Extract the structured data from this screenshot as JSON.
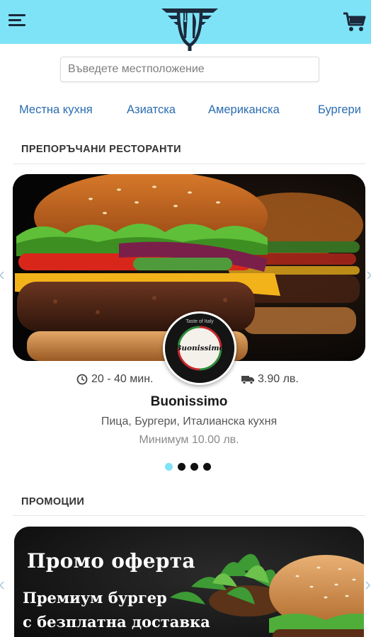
{
  "header": {
    "menu_icon": "hamburger-menu-icon",
    "logo_icon": "fork-knife-logo-icon",
    "cart_icon": "shopping-cart-icon",
    "bar_color": "#7fe3f7"
  },
  "search": {
    "placeholder": "Въведете местположение"
  },
  "categories": [
    "Местна кухня",
    "Азиатска",
    "Американска",
    "Бургери"
  ],
  "recommended": {
    "title": "ПРЕПОРЪЧАНИ РЕСТОРАНТИ",
    "restaurant": {
      "delivery_time": "20 - 40 мин.",
      "delivery_fee": "3.90 лв.",
      "name": "Buonissimo",
      "cuisine": "Пица, Бургери, Италианска кухня",
      "minimum": "Минимум 10.00 лв.",
      "logo_text": "Buonissimo",
      "logo_subtext": "Taste of Italy"
    },
    "carousel": {
      "slide_count": 4,
      "active_index": 0
    }
  },
  "promotions": {
    "title": "ПРОМОЦИИ",
    "banner": {
      "headline": "Промо оферта",
      "line1": "Премиум бургер",
      "line2": "с безплатна доставка"
    }
  }
}
